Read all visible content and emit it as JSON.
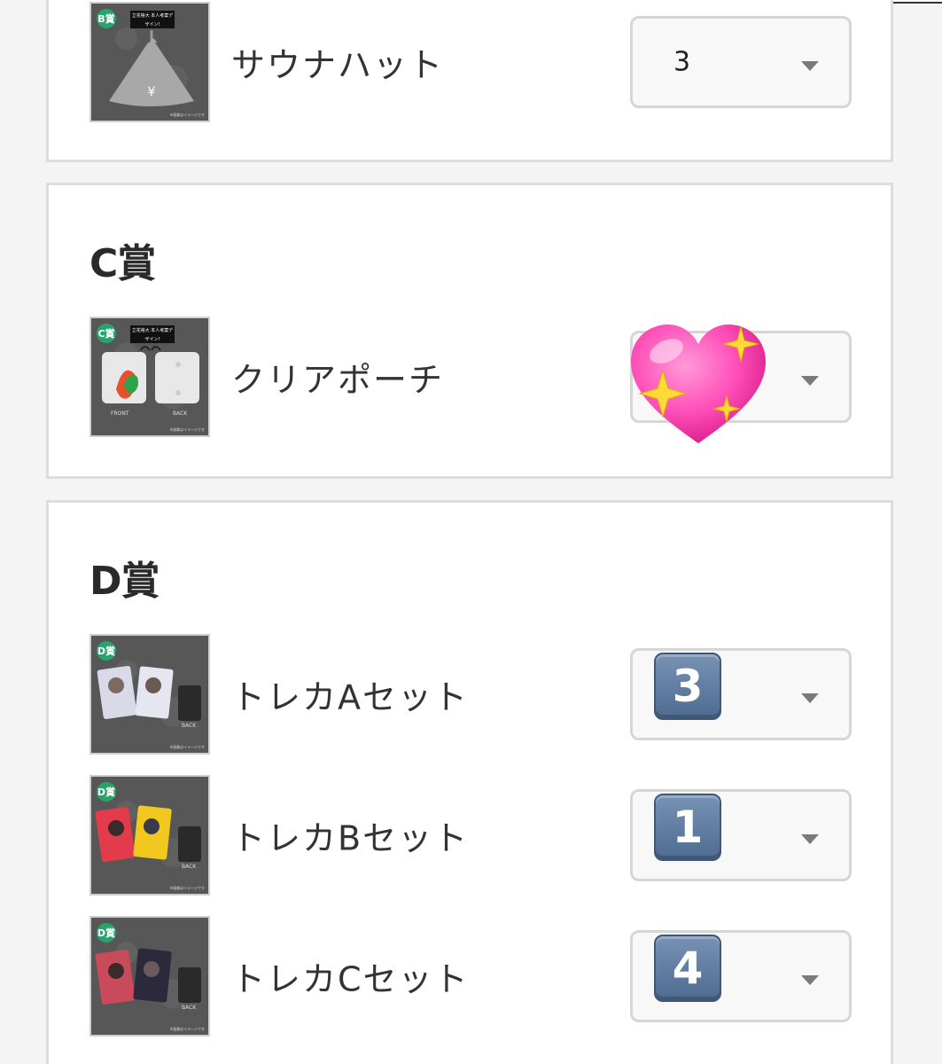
{
  "prizes": {
    "b": {
      "items": [
        {
          "badge": "B賞",
          "tag": "立花裕大 本人考案デザイン!",
          "name": "サウナハット",
          "quantity": "3",
          "copyright": "※画像はイメージです"
        }
      ]
    },
    "c": {
      "title": "C賞",
      "items": [
        {
          "badge": "C賞",
          "tag": "立花裕大 本人考案デザイン!",
          "name": "クリアポーチ",
          "quantity": "",
          "copyright": "※画像はイメージです",
          "front_label": "FRONT",
          "back_label": "BACK"
        }
      ]
    },
    "d": {
      "title": "D賞",
      "items": [
        {
          "badge": "D賞",
          "name": "トレカAセット",
          "quantity": "3",
          "back_label": "BACK",
          "copyright": "※画像はイメージです"
        },
        {
          "badge": "D賞",
          "name": "トレカBセット",
          "quantity": "1",
          "back_label": "BACK",
          "copyright": "※画像はイメージです"
        },
        {
          "badge": "D賞",
          "name": "トレカCセット",
          "quantity": "4",
          "back_label": "BACK",
          "copyright": "※画像はイメージです"
        }
      ]
    }
  },
  "overlay": {
    "sticker": "sparkling-heart-emoji"
  },
  "colors": {
    "badge": "#27a36b",
    "keycap": "#5f7ea6",
    "heart": "#ff4fb8"
  }
}
